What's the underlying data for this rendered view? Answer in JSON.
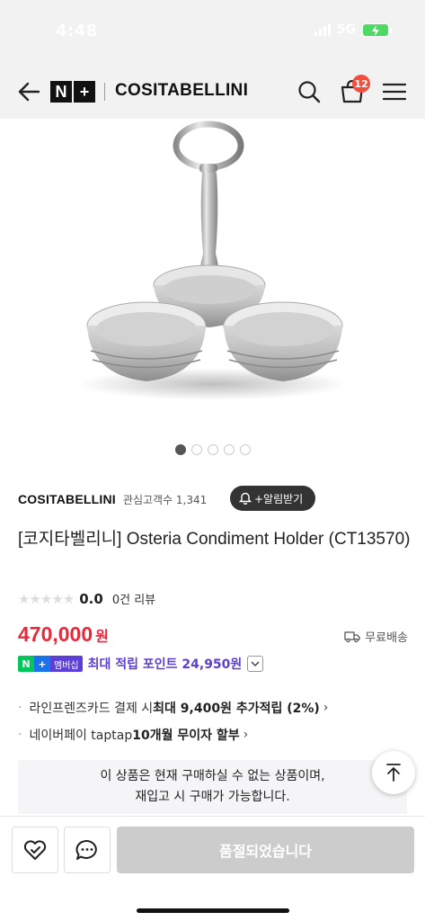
{
  "status_bar": {
    "time": "4:48",
    "network": "5G"
  },
  "header": {
    "brand_logo": [
      "N",
      "+"
    ],
    "brand_name": "COSITABELLINI",
    "cart_count": "12",
    "icons": [
      "back-arrow-icon",
      "search-icon",
      "shopping-bag-icon",
      "hamburger-menu-icon"
    ]
  },
  "gallery": {
    "image_count": 5,
    "active_index": 0
  },
  "store": {
    "name": "COSITABELLINI",
    "interest_label": "관심고객수 1,341",
    "notify_label": "+알림받기"
  },
  "product": {
    "title": "[코지타벨리니] Osteria Condiment Holder (CT13570)",
    "rating": "0.0",
    "review_count": "0건 리뷰",
    "stars": 0,
    "price": "470,000",
    "price_unit": "원",
    "shipping": "무료배송"
  },
  "membership": {
    "n_label": "N",
    "plus_label": "+",
    "badge_label": "멤버십",
    "points_text": "최대 적립 포인트 24,950원"
  },
  "benefits": [
    {
      "prefix": "라인프렌즈카드 결제 시 ",
      "bold": "최대 9,400원 추가적립 (2%)"
    },
    {
      "prefix": "네이버페이 taptap ",
      "bold": "10개월 무이자 할부"
    }
  ],
  "soldout_notice": {
    "line1": "이 상품은 현재 구매하실 수 없는 상품이며,",
    "line2": "재입고 시 구매가 가능합니다."
  },
  "bottom_bar": {
    "soldout_label": "품절되었습니다"
  },
  "colors": {
    "price": "#e8283b",
    "membership": "#5b3fd6",
    "naver_green": "#03c75a",
    "cart_badge": "#f04e3e"
  }
}
